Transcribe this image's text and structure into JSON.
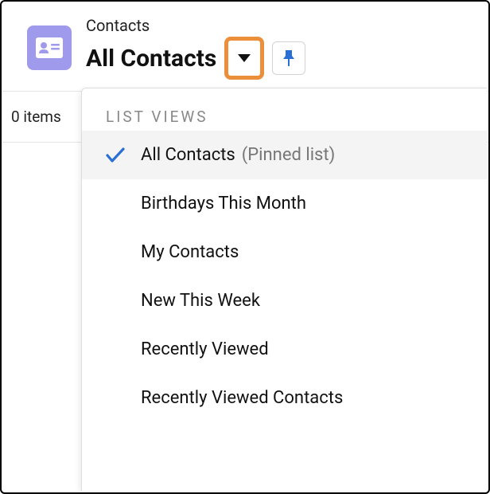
{
  "header": {
    "object_label": "Contacts",
    "view_title": "All Contacts"
  },
  "items_count_label": "0 items",
  "dropdown": {
    "heading": "LIST VIEWS",
    "items": [
      {
        "label": "All Contacts",
        "hint": "(Pinned list)",
        "selected": true
      },
      {
        "label": "Birthdays This Month",
        "hint": "",
        "selected": false
      },
      {
        "label": "My Contacts",
        "hint": "",
        "selected": false
      },
      {
        "label": "New This Week",
        "hint": "",
        "selected": false
      },
      {
        "label": "Recently Viewed",
        "hint": "",
        "selected": false
      },
      {
        "label": "Recently Viewed Contacts",
        "hint": "",
        "selected": false
      }
    ]
  },
  "colors": {
    "app_icon_bg": "#a09aec",
    "highlight_border": "#eb8f3a",
    "pin_icon": "#2a6fd6",
    "check_icon": "#2a6fd6"
  }
}
